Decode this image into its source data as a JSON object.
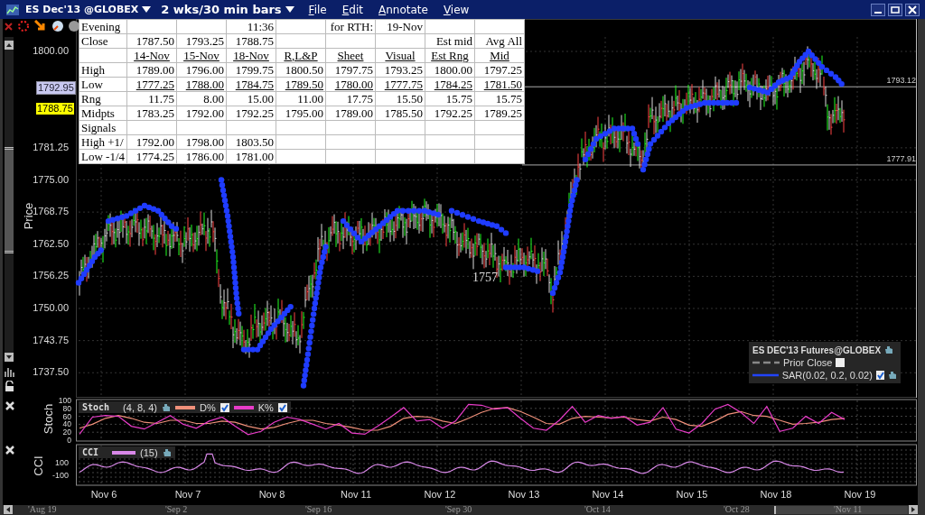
{
  "window": {
    "symbol": "ES Dec'13 @GLOBEX",
    "timeframe": "2 wks/30 min bars",
    "menu": [
      "File",
      "Edit",
      "Annotate",
      "View"
    ]
  },
  "table": {
    "rows": [
      {
        "kind": "text",
        "underlined": false,
        "cells": [
          "Evening",
          null,
          null,
          "11:36",
          null,
          "for RTH:",
          "19-Nov",
          null,
          null
        ]
      },
      {
        "kind": "text",
        "underlined": false,
        "cells": [
          "Close",
          "1787.50",
          "1793.25",
          "1788.75",
          null,
          null,
          null,
          "Est mid",
          "Avg All"
        ]
      },
      {
        "kind": "header",
        "underlined": true,
        "cells": [
          null,
          "14-Nov",
          "15-Nov",
          "18-Nov",
          "R,L&P",
          "Sheet",
          "Visual",
          "Est Rng",
          "Mid"
        ]
      },
      {
        "kind": "text",
        "underlined": false,
        "cells": [
          "High",
          "1789.00",
          "1796.00",
          "1799.75",
          "1800.50",
          "1797.75",
          "1793.25",
          "1800.00",
          "1797.25"
        ]
      },
      {
        "kind": "text",
        "underlined": true,
        "cells": [
          "Low",
          "1777.25",
          "1788.00",
          "1784.75",
          "1789.50",
          "1780.00",
          "1777.75",
          "1784.25",
          "1781.50"
        ]
      },
      {
        "kind": "text",
        "underlined": false,
        "cells": [
          "Rng",
          "11.75",
          "8.00",
          "15.00",
          "11.00",
          "17.75",
          "15.50",
          "15.75",
          "15.75"
        ]
      },
      {
        "kind": "text",
        "underlined": false,
        "cells": [
          "Midpts",
          "1783.25",
          "1792.00",
          "1792.25",
          "1795.00",
          "1789.00",
          "1785.50",
          "1792.25",
          "1789.25"
        ]
      },
      {
        "kind": "text",
        "cells": [
          "Signals",
          null,
          null,
          null,
          null,
          null,
          null,
          null,
          null
        ]
      },
      {
        "kind": "text",
        "underlined": false,
        "cells": [
          "High +1/",
          "1792.00",
          "1798.00",
          "1803.50",
          null,
          null,
          null,
          null,
          null
        ]
      },
      {
        "kind": "text",
        "underlined": false,
        "cells": [
          "Low -1/4",
          "1774.25",
          "1786.00",
          "1781.00",
          null,
          null,
          null,
          null,
          null
        ]
      }
    ]
  },
  "price_axis": {
    "label": "Price",
    "ticks": [
      "1800.00",
      "1781.25",
      "1775.00",
      "1768.75",
      "1762.50",
      "1756.25",
      "1750.00",
      "1743.75",
      "1737.50"
    ]
  },
  "price_tags": [
    {
      "text": "1792.95",
      "kind": "bid"
    },
    {
      "text": "1788.75",
      "kind": "last"
    }
  ],
  "levels": [
    {
      "text": "1793.12"
    },
    {
      "text": "1777.91"
    }
  ],
  "annotation": "1757",
  "legend": {
    "title": "ES DEC'13 Futures@GLOBEX",
    "items": [
      {
        "label": "Prior Close",
        "kind": "dashed",
        "checked": false
      },
      {
        "label": "SAR(0.02, 0.2, 0.02)",
        "kind": "solid",
        "checked": true
      }
    ]
  },
  "stoch": {
    "name": "Stoch",
    "params": "(4, 8, 4)",
    "lines": [
      {
        "checked": true
      },
      {
        "checked": true
      }
    ],
    "chart_data": {
      "type": "line",
      "grid": true,
      "ylabel": "Stoch",
      "ylim": [
        0,
        100
      ],
      "yticks": [
        {
          "value": 100,
          "label": "100"
        },
        {
          "value": 80,
          "label": "80"
        },
        {
          "value": 60,
          "label": "60"
        },
        {
          "value": 40,
          "label": "40"
        },
        {
          "value": 20,
          "label": "20"
        },
        {
          "value": 0,
          "label": "0"
        }
      ],
      "series": [
        {
          "name": "D%",
          "color": "#f0907a",
          "values": [
            30,
            40,
            55,
            62,
            55,
            45,
            42,
            50,
            50,
            42,
            42,
            48,
            45,
            35,
            28,
            32,
            42,
            50,
            50,
            42,
            38,
            32,
            25,
            25,
            35,
            55,
            60,
            58,
            48,
            42,
            55,
            70,
            80,
            82,
            72,
            58,
            42,
            40,
            55,
            60,
            58,
            56,
            58,
            52,
            48,
            58,
            52,
            38,
            35,
            48,
            65,
            72,
            62,
            60,
            50,
            40,
            42,
            45,
            52,
            55
          ]
        },
        {
          "name": "K%",
          "color": "#e83cc8",
          "values": [
            15,
            58,
            62,
            60,
            35,
            28,
            45,
            62,
            40,
            30,
            48,
            58,
            35,
            14,
            22,
            45,
            58,
            52,
            40,
            28,
            42,
            18,
            15,
            35,
            58,
            82,
            48,
            52,
            30,
            48,
            90,
            88,
            78,
            82,
            55,
            30,
            25,
            50,
            85,
            45,
            62,
            55,
            60,
            38,
            45,
            82,
            28,
            18,
            42,
            78,
            90,
            70,
            42,
            85,
            22,
            30,
            60,
            42,
            70,
            52
          ]
        }
      ]
    }
  },
  "cci": {
    "label": "CCI",
    "name": "CCI",
    "params": "(15)",
    "color": "#d888e8",
    "ticks": [
      "100",
      "-100"
    ]
  },
  "dates": [
    "Nov 6",
    "Nov 7",
    "Nov 8",
    "Nov 11",
    "Nov 12",
    "Nov 13",
    "Nov 14",
    "Nov 15",
    "Nov 18",
    "Nov 19"
  ],
  "scroll_dates": [
    "'Aug 19",
    "'Sep 2",
    "'Sep 16",
    "'Sep 30",
    "'Oct 14",
    "'Oct 28",
    "'Nov 11"
  ]
}
